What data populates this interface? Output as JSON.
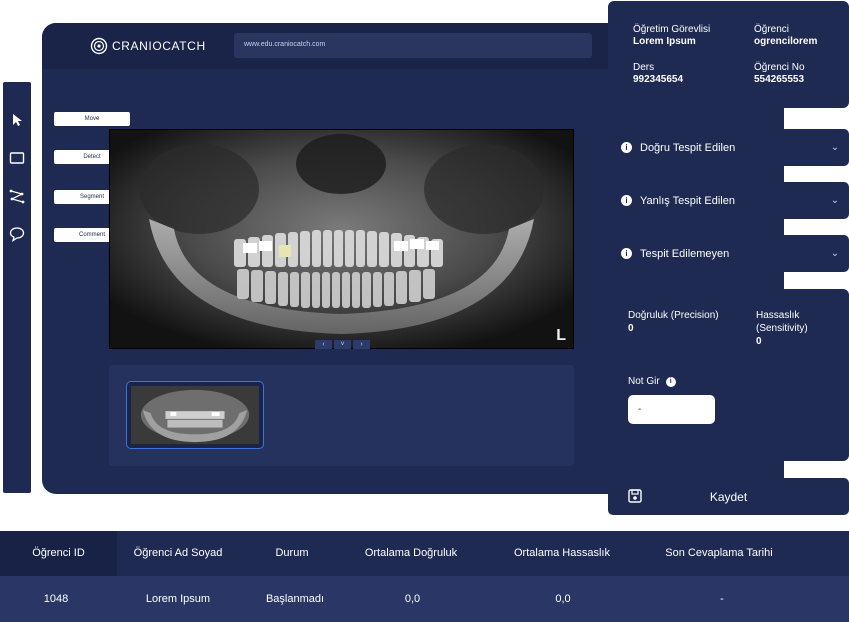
{
  "header": {
    "brand": "CRANIOCATCH",
    "url": "www.edu.craniocatch.com"
  },
  "toolbar": {
    "icons": [
      "pointer-icon",
      "rectangle-icon",
      "polyline-icon",
      "comment-icon"
    ],
    "labels": [
      "Move",
      "Detect",
      "Segment",
      "Comment"
    ]
  },
  "viewer": {
    "orientation_marker": "L",
    "nav": [
      "‹",
      "˅",
      "›"
    ]
  },
  "info": {
    "instructor_label": "Öğretim Görevlisi",
    "instructor_value": "Lorem Ipsum",
    "student_label": "Öğrenci",
    "student_value": "ogrencilorem",
    "course_label": "Ders",
    "course_value": "992345654",
    "student_no_label": "Öğrenci No",
    "student_no_value": "554265553"
  },
  "accordions": [
    {
      "label": "Doğru Tespit Edilen"
    },
    {
      "label": "Yanlış Tespit Edilen"
    },
    {
      "label": "Tespit Edilemeyen"
    }
  ],
  "metrics": {
    "precision_label": "Doğruluk (Precision)",
    "precision_value": "0",
    "sensitivity_label": "Hassaslık (Sensitivity)",
    "sensitivity_value": "0",
    "grade_label": "Not Gir",
    "grade_value": "-"
  },
  "save": {
    "label": "Kaydet"
  },
  "table": {
    "headers": [
      "Öğrenci ID",
      "Öğrenci Ad Soyad",
      "Durum",
      "Ortalama Doğruluk",
      "Ortalama Hassaslık",
      "Son Cevaplama Tarihi"
    ],
    "rows": [
      [
        "1048",
        "Lorem Ipsum",
        "Başlanmadı",
        "0,0",
        "0,0",
        "-"
      ]
    ]
  },
  "colors": {
    "panel": "#1e2a52",
    "accent": "#3f74d6"
  }
}
